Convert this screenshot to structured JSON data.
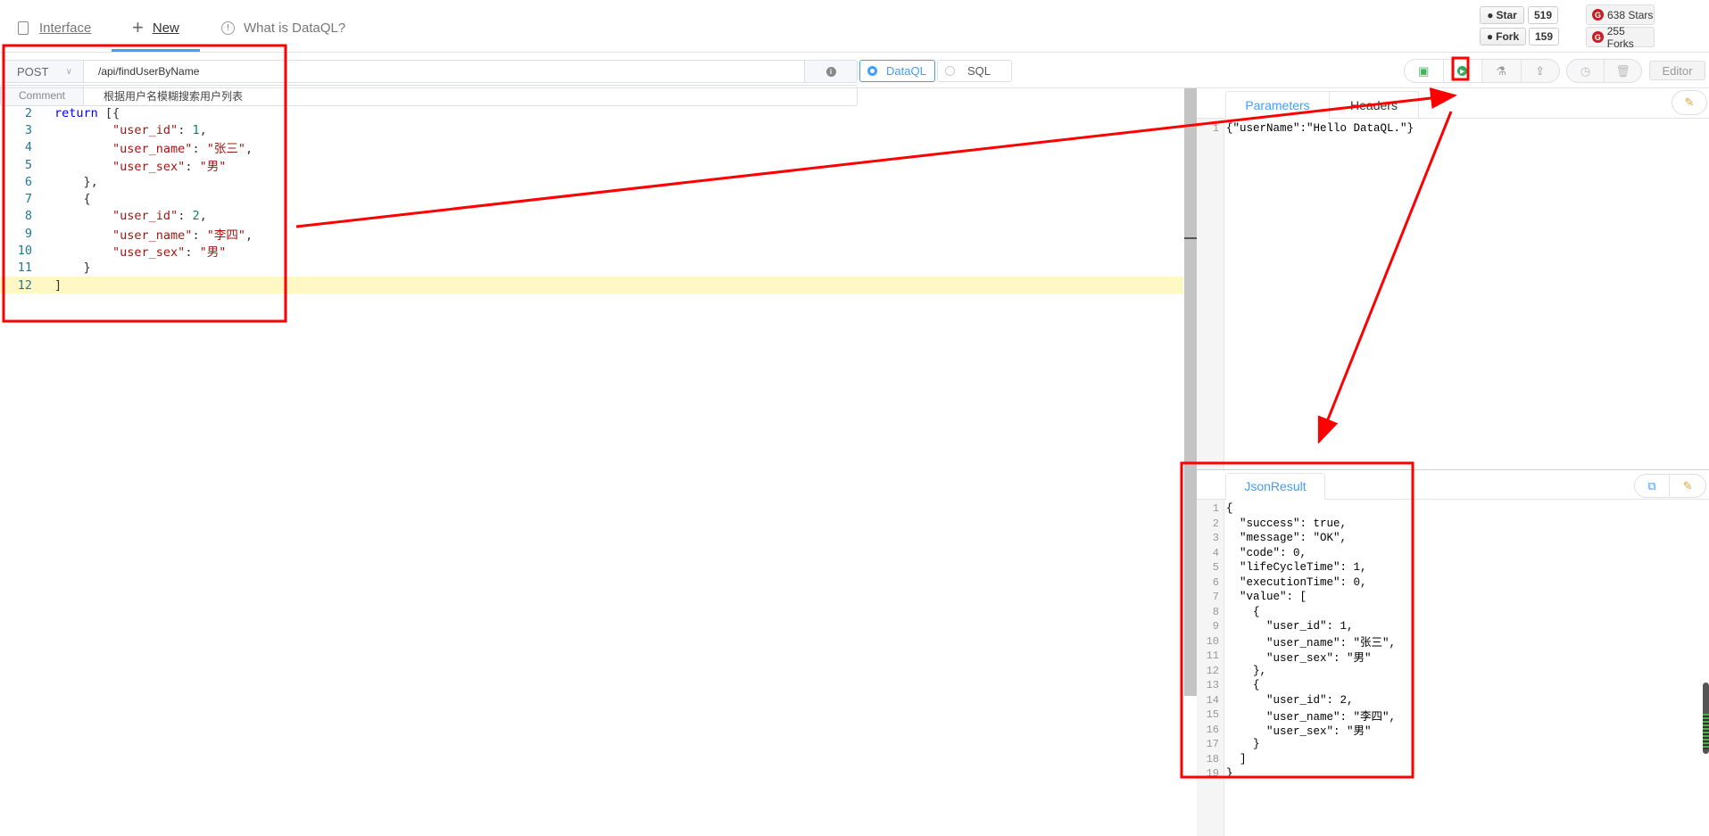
{
  "nav": {
    "interface": "Interface",
    "new": "New",
    "what": "What is DataQL?"
  },
  "github": {
    "star_label": "Star",
    "star_count": "519",
    "fork_label": "Fork",
    "fork_count": "159"
  },
  "gitee": {
    "stars": "638 Stars",
    "forks": "255 Forks"
  },
  "request": {
    "method": "POST",
    "path": "/api/findUserByName",
    "comment_label": "Comment",
    "comment": "根据用户名模糊搜索用户列表"
  },
  "mode": {
    "options": [
      "DataQL",
      "SQL"
    ],
    "selected": "DataQL"
  },
  "toolbar": {
    "editor_label": "Editor",
    "icons": [
      "save-icon",
      "run-icon",
      "test-icon",
      "publish-icon",
      "history-icon",
      "delete-icon"
    ]
  },
  "editor": {
    "lines": [
      {
        "n": "2",
        "html": "<span class='k'>return</span> [{"
      },
      {
        "n": "3",
        "html": "        <span class='key'>\"user_id\"</span>: <span class='n'>1</span>,"
      },
      {
        "n": "4",
        "html": "        <span class='key'>\"user_name\"</span>: <span class='s'>\"张三\"</span>,"
      },
      {
        "n": "5",
        "html": "        <span class='key'>\"user_sex\"</span>: <span class='s'>\"男\"</span>"
      },
      {
        "n": "6",
        "html": "    },"
      },
      {
        "n": "7",
        "html": "    {"
      },
      {
        "n": "8",
        "html": "        <span class='key'>\"user_id\"</span>: <span class='n'>2</span>,"
      },
      {
        "n": "9",
        "html": "        <span class='key'>\"user_name\"</span>: <span class='s'>\"李四\"</span>,"
      },
      {
        "n": "10",
        "html": "        <span class='key'>\"user_sex\"</span>: <span class='s'>\"男\"</span>"
      },
      {
        "n": "11",
        "html": "    }"
      },
      {
        "n": "12",
        "html": "]"
      }
    ]
  },
  "params": {
    "tabs": [
      "Parameters",
      "Headers"
    ],
    "active": "Parameters",
    "lines": [
      "{\"userName\":\"Hello DataQL.\"}"
    ]
  },
  "result": {
    "tab": "JsonResult",
    "lines": [
      "{",
      "  \"success\": true,",
      "  \"message\": \"OK\",",
      "  \"code\": 0,",
      "  \"lifeCycleTime\": 1,",
      "  \"executionTime\": 0,",
      "  \"value\": [",
      "    {",
      "      \"user_id\": 1,",
      "      \"user_name\": \"张三\",",
      "      \"user_sex\": \"男\"",
      "    },",
      "    {",
      "      \"user_id\": 2,",
      "      \"user_name\": \"李四\",",
      "      \"user_sex\": \"男\"",
      "    }",
      "  ]",
      "}"
    ]
  },
  "colors": {
    "accent": "#409eff",
    "annotation": "#ff0000",
    "highlight_line": "#fff8c5"
  }
}
